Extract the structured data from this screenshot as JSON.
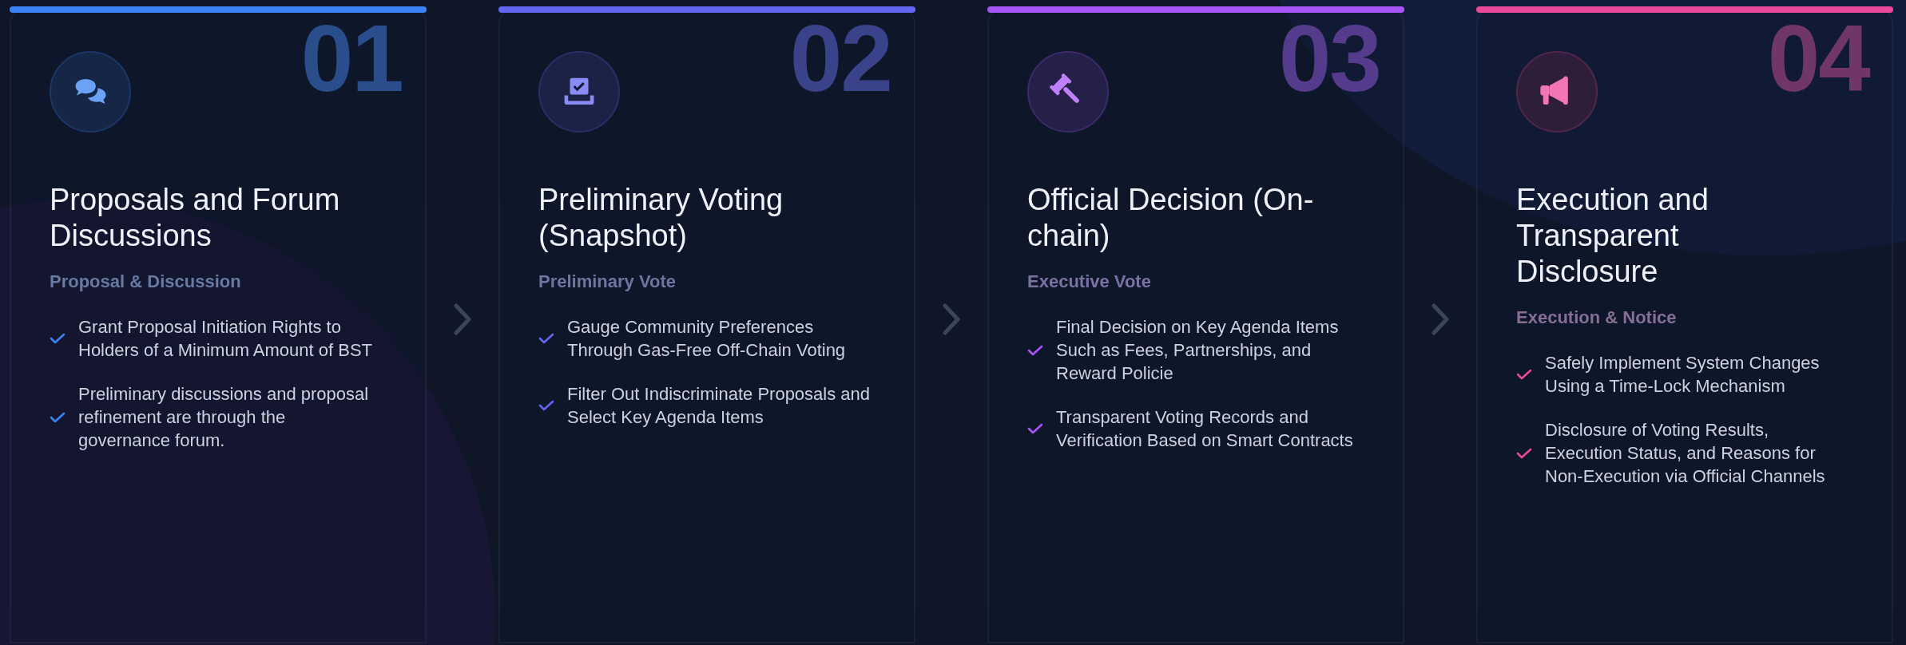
{
  "steps": [
    {
      "number": "01",
      "kind": "discussion",
      "color": "#3b82f6",
      "title": "Proposals and Forum Discussions",
      "subtitle": "Proposal & Discussion",
      "points": [
        "Grant Proposal Initiation Rights to Holders of a Minimum Amount of BST",
        "Preliminary discussions and proposal refinement are through the governance forum."
      ]
    },
    {
      "number": "02",
      "kind": "vote",
      "color": "#6366f1",
      "title": "Preliminary Voting (Snapshot)",
      "subtitle": "Preliminary Vote",
      "points": [
        "Gauge Community Preferences Through Gas-Free Off-Chain Voting",
        "Filter Out Indiscriminate Proposals and Select Key Agenda Items"
      ]
    },
    {
      "number": "03",
      "kind": "decision",
      "color": "#a855f7",
      "title": "Official Decision (On-chain)",
      "subtitle": "Executive Vote",
      "points": [
        "Final Decision on Key Agenda Items Such as Fees, Partnerships, and Reward Policie",
        "Transparent Voting Records and Verification Based on Smart Contracts"
      ]
    },
    {
      "number": "04",
      "kind": "announcement",
      "color": "#ec4899",
      "title": "Execution and Transparent Disclosure",
      "subtitle": "Execution & Notice",
      "points": [
        "Safely Implement System Changes Using a Time-Lock Mechanism",
        "Disclosure of Voting Results, Execution Status, and Reasons for Non-Execution via Official Channels"
      ]
    }
  ]
}
